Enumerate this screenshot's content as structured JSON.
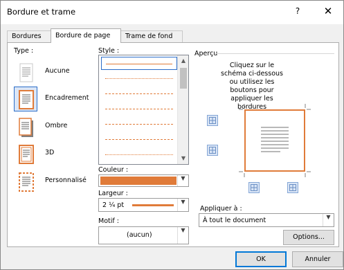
{
  "window": {
    "title": "Bordure et trame",
    "help": "?",
    "close": "✕"
  },
  "tabs": [
    {
      "label": "Bordures"
    },
    {
      "label": "Bordure de page"
    },
    {
      "label": "Trame de fond"
    }
  ],
  "type_section": {
    "label": "Type :",
    "items": [
      {
        "label": "Aucune"
      },
      {
        "label": "Encadrement"
      },
      {
        "label": "Ombre"
      },
      {
        "label": "3D"
      },
      {
        "label": "Personnalisé"
      }
    ]
  },
  "style_section": {
    "label": "Style :"
  },
  "color": {
    "label": "Couleur :",
    "value_color": "#e07b39"
  },
  "width": {
    "label": "Largeur :",
    "value": "2 ¼ pt"
  },
  "motif": {
    "label": "Motif :",
    "value": "(aucun)"
  },
  "preview": {
    "label": "Aperçu",
    "instructions": "Cliquez sur le schéma ci-dessous ou utilisez les boutons pour appliquer les bordures"
  },
  "apply": {
    "label": "Appliquer à :",
    "value": "À tout le document"
  },
  "buttons": {
    "options": "Options...",
    "ok": "OK",
    "cancel": "Annuler"
  },
  "colors": {
    "accent": "#e07b39",
    "selection": "#2a6cc8"
  }
}
